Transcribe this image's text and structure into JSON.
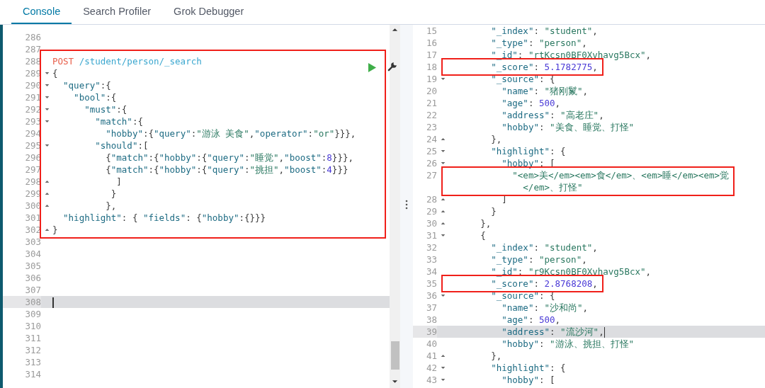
{
  "tabs": [
    {
      "label": "Console",
      "selected": true
    },
    {
      "label": "Search Profiler",
      "selected": false
    },
    {
      "label": "Grok Debugger",
      "selected": false
    }
  ],
  "request_editor": {
    "segments": [
      {
        "boxed": false,
        "lines": [
          {
            "number": "286",
            "kind": "plain",
            "active": false
          },
          {
            "number": "287",
            "kind": "plain",
            "active": false
          }
        ]
      },
      {
        "boxed": true,
        "lines": [
          {
            "number": "288",
            "kind": "request",
            "text": "POST /student/person/_search",
            "active": false
          },
          {
            "number": "289",
            "kind": "opener",
            "text": "{",
            "active": false
          },
          {
            "number": "290",
            "kind": "opener",
            "text": "  \"query\":{",
            "active": false
          },
          {
            "number": "291",
            "kind": "opener",
            "text": "    \"bool\":{",
            "active": false
          },
          {
            "number": "292",
            "kind": "opener",
            "text": "      \"must\":{",
            "active": false
          },
          {
            "number": "293",
            "kind": "opener",
            "text": "        \"match\":{",
            "active": false
          },
          {
            "number": "294",
            "kind": "plain",
            "text": "          \"hobby\":{\"query\":\"游泳 美食\",\"operator\":\"or\"}}},",
            "active": false
          },
          {
            "number": "295",
            "kind": "opener",
            "text": "        \"should\":[",
            "active": false
          },
          {
            "number": "296",
            "kind": "plain",
            "text": "          {\"match\":{\"hobby\":{\"query\":\"睡觉\",\"boost\":8}}},",
            "active": false
          },
          {
            "number": "297",
            "kind": "plain",
            "text": "          {\"match\":{\"hobby\":{\"query\":\"挑担\",\"boost\":4}}}",
            "active": false
          },
          {
            "number": "298",
            "kind": "closer",
            "text": "            ]",
            "active": false
          },
          {
            "number": "299",
            "kind": "closer",
            "text": "           }",
            "active": false
          },
          {
            "number": "300",
            "kind": "closer",
            "text": "          },",
            "active": false
          },
          {
            "number": "301",
            "kind": "plain",
            "text": "  \"highlight\": { \"fields\": {\"hobby\":{}}}",
            "active": false
          },
          {
            "number": "302",
            "kind": "closer",
            "text": "}",
            "active": false
          }
        ]
      },
      {
        "boxed": false,
        "lines": [
          {
            "number": "303",
            "kind": "plain",
            "active": false
          },
          {
            "number": "304",
            "kind": "plain",
            "active": false
          },
          {
            "number": "305",
            "kind": "plain",
            "active": false
          },
          {
            "number": "306",
            "kind": "plain",
            "active": false
          },
          {
            "number": "307",
            "kind": "plain",
            "active": false
          },
          {
            "number": "308",
            "kind": "plain",
            "active": true
          },
          {
            "number": "309",
            "kind": "plain",
            "active": false
          },
          {
            "number": "310",
            "kind": "plain",
            "active": false
          },
          {
            "number": "311",
            "kind": "plain",
            "active": false
          },
          {
            "number": "312",
            "kind": "plain",
            "active": false
          },
          {
            "number": "313",
            "kind": "plain",
            "active": false
          },
          {
            "number": "314",
            "kind": "plain",
            "active": false
          }
        ]
      }
    ]
  },
  "response_viewer": {
    "segments": [
      {
        "boxed": false,
        "lines": [
          {
            "number": "15",
            "kind": "plain",
            "text": "        \"_index\": \"student\",",
            "active": false
          },
          {
            "number": "16",
            "kind": "plain",
            "text": "        \"_type\": \"person\",",
            "active": false
          },
          {
            "number": "17",
            "kind": "plain",
            "text": "        \"_id\": \"rtKcsn0BF0Xvhavg5Bcx\",",
            "active": false
          }
        ]
      },
      {
        "boxed": true,
        "lines": [
          {
            "number": "18",
            "kind": "plain",
            "text": "        \"_score\": 5.1782775,",
            "active": false
          }
        ]
      },
      {
        "boxed": false,
        "lines": [
          {
            "number": "19",
            "kind": "opener",
            "text": "        \"_source\": {",
            "active": false
          },
          {
            "number": "20",
            "kind": "plain",
            "text": "          \"name\": \"猪刚鬣\",",
            "active": false
          },
          {
            "number": "21",
            "kind": "plain",
            "text": "          \"age\": 500,",
            "active": false
          },
          {
            "number": "22",
            "kind": "plain",
            "text": "          \"address\": \"高老庄\",",
            "active": false
          },
          {
            "number": "23",
            "kind": "plain",
            "text": "          \"hobby\": \"美食、睡觉、打怪\"",
            "active": false
          },
          {
            "number": "24",
            "kind": "closer",
            "text": "        },",
            "active": false
          },
          {
            "number": "25",
            "kind": "opener",
            "text": "        \"highlight\": {",
            "active": false
          },
          {
            "number": "26",
            "kind": "opener",
            "text": "          \"hobby\": [",
            "active": false
          }
        ]
      },
      {
        "boxed": true,
        "lines": [
          {
            "number": "27",
            "kind": "plain",
            "text": "            \"<em>美</em><em>食</em>、<em>睡</em><em>觉</em>、打怪\"",
            "active": false
          }
        ]
      },
      {
        "boxed": false,
        "lines": [
          {
            "number": "28",
            "kind": "closer",
            "text": "          ]",
            "active": false
          },
          {
            "number": "29",
            "kind": "closer",
            "text": "        }",
            "active": false
          },
          {
            "number": "30",
            "kind": "closer",
            "text": "      },",
            "active": false
          },
          {
            "number": "31",
            "kind": "opener",
            "text": "      {",
            "active": false
          },
          {
            "number": "32",
            "kind": "plain",
            "text": "        \"_index\": \"student\",",
            "active": false
          },
          {
            "number": "33",
            "kind": "plain",
            "text": "        \"_type\": \"person\",",
            "active": false
          },
          {
            "number": "34",
            "kind": "plain",
            "text": "        \"_id\": \"r9Kcsn0BF0Xvhavg5Bcx\",",
            "active": false
          }
        ]
      },
      {
        "boxed": true,
        "lines": [
          {
            "number": "35",
            "kind": "plain",
            "text": "        \"_score\": 2.8768208,",
            "active": false
          }
        ]
      },
      {
        "boxed": false,
        "lines": [
          {
            "number": "36",
            "kind": "opener",
            "text": "        \"_source\": {",
            "active": false
          },
          {
            "number": "37",
            "kind": "plain",
            "text": "          \"name\": \"沙和尚\",",
            "active": false
          },
          {
            "number": "38",
            "kind": "plain",
            "text": "          \"age\": 500,",
            "active": false
          },
          {
            "number": "39",
            "kind": "plain",
            "text": "          \"address\": \"流沙河\",",
            "active": true
          },
          {
            "number": "40",
            "kind": "plain",
            "text": "          \"hobby\": \"游泳、挑担、打怪\"",
            "active": false
          },
          {
            "number": "41",
            "kind": "closer",
            "text": "        },",
            "active": false
          },
          {
            "number": "42",
            "kind": "opener",
            "text": "        \"highlight\": {",
            "active": false
          },
          {
            "number": "43",
            "kind": "opener",
            "text": "          \"hobby\": [",
            "active": false
          }
        ]
      }
    ]
  }
}
